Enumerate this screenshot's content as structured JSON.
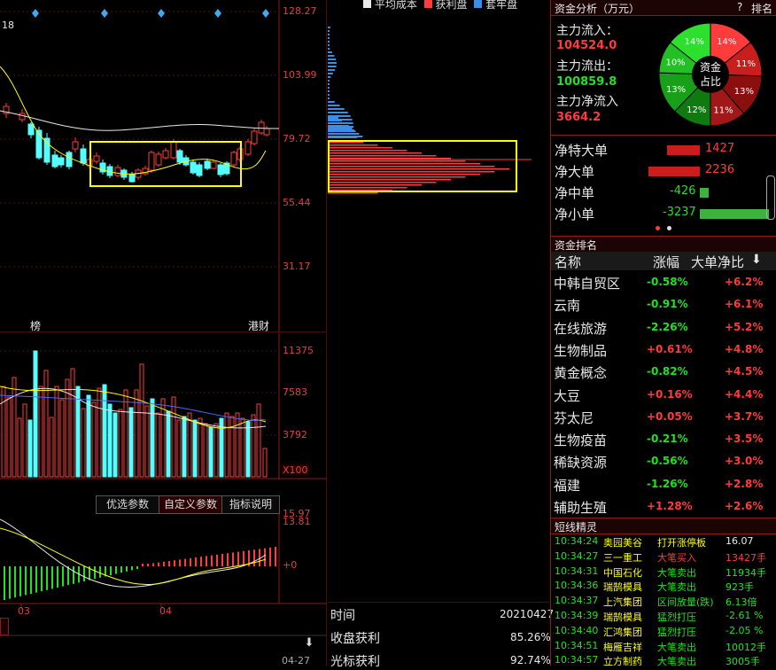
{
  "main_chart": {
    "top_label": "18",
    "price_axis": [
      "128.27",
      "103.99",
      "79.72",
      "55.44",
      "31.17"
    ],
    "bottom_tags": [
      "榜",
      "港财"
    ]
  },
  "volume_chart": {
    "axis": [
      "11375",
      "7583",
      "3792"
    ],
    "multiplier": "X100"
  },
  "indicator": {
    "tabs": [
      "优选参数",
      "自定义参数",
      "指标说明"
    ],
    "axis_top": [
      "15.97",
      "13.81"
    ],
    "axis_zero": "+0",
    "dates": [
      "03",
      "04"
    ],
    "last_date": "04-27"
  },
  "chip_legend": [
    "平均成本",
    "获利盘",
    "套牢盘"
  ],
  "chip_stats": {
    "time_label": "时间",
    "time_value": "20210427",
    "profit_label": "收盘获利",
    "profit_value": "85.26%",
    "cursor_label": "光标获利",
    "cursor_value": "92.74%"
  },
  "fund": {
    "title": "资金分析（万元）",
    "help": "?",
    "rank_link": "排名",
    "inflow_label": "主力流入：",
    "inflow_value": "104524.0",
    "outflow_label": "主力流出：",
    "outflow_value": "100859.8",
    "net_label": "主力净流入",
    "net_value": "3664.2",
    "pie_center": [
      "资金",
      "占比"
    ],
    "pie_labels": [
      "14%",
      "11%",
      "13%",
      "11%",
      "12%",
      "13%",
      "10%",
      "14%"
    ],
    "bars": [
      {
        "label": "净特大单",
        "value": "1427",
        "color": "#ff3b3b"
      },
      {
        "label": "净大单",
        "value": "2236",
        "color": "#ff3b3b"
      },
      {
        "label": "净中单",
        "value": "-426",
        "color": "#22e022"
      },
      {
        "label": "净小单",
        "value": "-3237",
        "color": "#22e022"
      }
    ]
  },
  "ranking": {
    "title": "资金排名",
    "headers": [
      "名称",
      "涨幅",
      "大单净比"
    ],
    "rows": [
      {
        "name": "中韩自贸区",
        "change": "-0.58%",
        "ratio": "+6.2%"
      },
      {
        "name": "云南",
        "change": "-0.91%",
        "ratio": "+6.1%"
      },
      {
        "name": "在线旅游",
        "change": "-2.26%",
        "ratio": "+5.2%"
      },
      {
        "name": "生物制品",
        "change": "+0.61%",
        "ratio": "+4.8%"
      },
      {
        "name": "黄金概念",
        "change": "-0.82%",
        "ratio": "+4.5%"
      },
      {
        "name": "大豆",
        "change": "+0.16%",
        "ratio": "+4.4%"
      },
      {
        "name": "芬太尼",
        "change": "+0.05%",
        "ratio": "+3.7%"
      },
      {
        "name": "生物疫苗",
        "change": "-0.21%",
        "ratio": "+3.5%"
      },
      {
        "name": "稀缺资源",
        "change": "-0.56%",
        "ratio": "+3.0%"
      },
      {
        "name": "福建",
        "change": "-1.26%",
        "ratio": "+2.8%"
      },
      {
        "name": "辅助生殖",
        "change": "+1.28%",
        "ratio": "+2.6%"
      }
    ]
  },
  "shortline": {
    "title": "短线精灵",
    "rows": [
      {
        "time": "10:34:24",
        "name": "奥园美谷",
        "action": "打开涨停板",
        "value": "16.07",
        "action_color": "#ffff00",
        "value_color": "#e8e8e8"
      },
      {
        "time": "10:34:27",
        "name": "三一重工",
        "action": "大笔买入",
        "value": "13427手",
        "action_color": "#ff3b3b",
        "value_color": "#ff3b3b"
      },
      {
        "time": "10:34:31",
        "name": "中国石化",
        "action": "大笔卖出",
        "value": "11934手",
        "action_color": "#22e022",
        "value_color": "#22e022"
      },
      {
        "time": "10:34:36",
        "name": "瑞鹄模具",
        "action": "大笔卖出",
        "value": "923手",
        "action_color": "#22e022",
        "value_color": "#22e022"
      },
      {
        "time": "10:34:37",
        "name": "上汽集团",
        "action": "区间放量(跌)",
        "value": "6.13倍",
        "action_color": "#22e022",
        "value_color": "#22e022"
      },
      {
        "time": "10:34:39",
        "name": "瑞鹄模具",
        "action": "猛烈打压",
        "value": "-2.61 %",
        "action_color": "#22e022",
        "value_color": "#22e022"
      },
      {
        "time": "10:34:40",
        "name": "汇鸿集团",
        "action": "猛烈打压",
        "value": "-2.05 %",
        "action_color": "#22e022",
        "value_color": "#22e022"
      },
      {
        "time": "10:34:51",
        "name": "梅雁吉祥",
        "action": "大笔卖出",
        "value": "10012手",
        "action_color": "#22e022",
        "value_color": "#22e022"
      },
      {
        "time": "10:34:57",
        "name": "立方制药",
        "action": "大笔卖出",
        "value": "3005手",
        "action_color": "#22e022",
        "value_color": "#22e022"
      }
    ]
  }
}
